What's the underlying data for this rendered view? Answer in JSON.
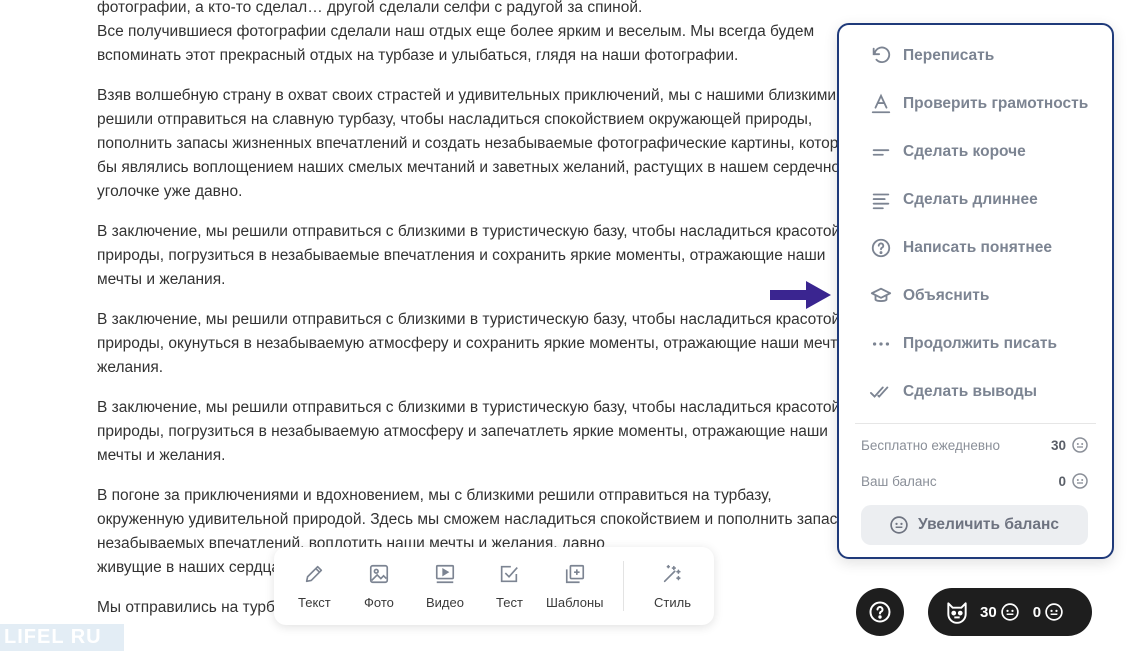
{
  "document": {
    "paragraphs": [
      "фотографии, а кто-то сделал… другой сделали селфи с радугой за спиной.",
      "Все получившиеся фотографии сделали наш отдых еще более ярким и веселым. Мы всегда будем",
      "вспоминать этот прекрасный отдых на турбазе и улыбаться, глядя на наши фотографии.",
      "Взяв волшебную страну в охват своих страстей и удивительных приключений, мы с нашими близкими",
      "решили отправиться на славную турбазу, чтобы насладиться спокойствием окружающей природы,",
      "пополнить запасы жизненных впечатлений и создать незабываемые фотографические картины, которые",
      "бы являлись воплощением наших смелых мечтаний и заветных желаний, растущих в нашем сердечном",
      "уголочке уже давно.",
      "В заключение, мы решили отправиться с близкими в туристическую базу, чтобы насладиться красотой",
      "природы, погрузиться в незабываемые впечатления и сохранить яркие моменты, отражающие наши",
      "мечты и желания.",
      "В заключение, мы решили отправиться с близкими в туристическую базу, чтобы насладиться красотой",
      "природы, окунуться в незабываемую атмосферу и сохранить яркие моменты, отражающие наши мечты и",
      "желания.",
      "В заключение, мы решили отправиться с близкими в туристическую базу, чтобы насладиться красотой",
      "природы, погрузиться в незабываемую атмосферу и запечатлеть яркие моменты, отражающие наши",
      "мечты и желания.",
      "В погоне за приключениями и вдохновением, мы с близкими решили отправиться на турбазу,",
      "окруженную удивительной природой. Здесь мы сможем насладиться спокойствием и пополнить запас",
      "незабываемых впечатлений, воплотить наши мечты и желания, давно",
      "живущие в наших сердцах.",
      "Мы отправились на турбазу, чтобы сделать незабываемые фотографии."
    ]
  },
  "ai_menu": {
    "items": [
      {
        "label": "Переписать",
        "icon": "undo-icon"
      },
      {
        "label": "Проверить грамотность",
        "icon": "spellcheck-icon"
      },
      {
        "label": "Сделать короче",
        "icon": "short-lines-icon"
      },
      {
        "label": "Сделать длиннее",
        "icon": "long-lines-icon"
      },
      {
        "label": "Написать понятнее",
        "icon": "question-circle-icon"
      },
      {
        "label": "Объяснить",
        "icon": "graduation-cap-icon"
      },
      {
        "label": "Продолжить писать",
        "icon": "ellipsis-icon"
      },
      {
        "label": "Сделать выводы",
        "icon": "double-check-icon"
      }
    ],
    "free_daily_label": "Бесплатно ежедневно",
    "free_daily_value": "30",
    "balance_label": "Ваш баланс",
    "balance_value": "0",
    "increase_button": "Увеличить баланс"
  },
  "toolbar": {
    "items": [
      {
        "label": "Текст",
        "icon": "pencil-icon"
      },
      {
        "label": "Фото",
        "icon": "image-icon"
      },
      {
        "label": "Видео",
        "icon": "video-icon"
      },
      {
        "label": "Тест",
        "icon": "checkbox-icon"
      },
      {
        "label": "Шаблоны",
        "icon": "templates-icon"
      },
      {
        "label": "Стиль",
        "icon": "magic-wand-icon"
      }
    ]
  },
  "status": {
    "free_count": "30",
    "balance_count": "0"
  },
  "watermark": "LIFEL RU",
  "colors": {
    "accent_border": "#1f3a7a",
    "arrow": "#3a2590",
    "menu_text": "#7c8492",
    "dark_pill": "#1e1e1e"
  }
}
